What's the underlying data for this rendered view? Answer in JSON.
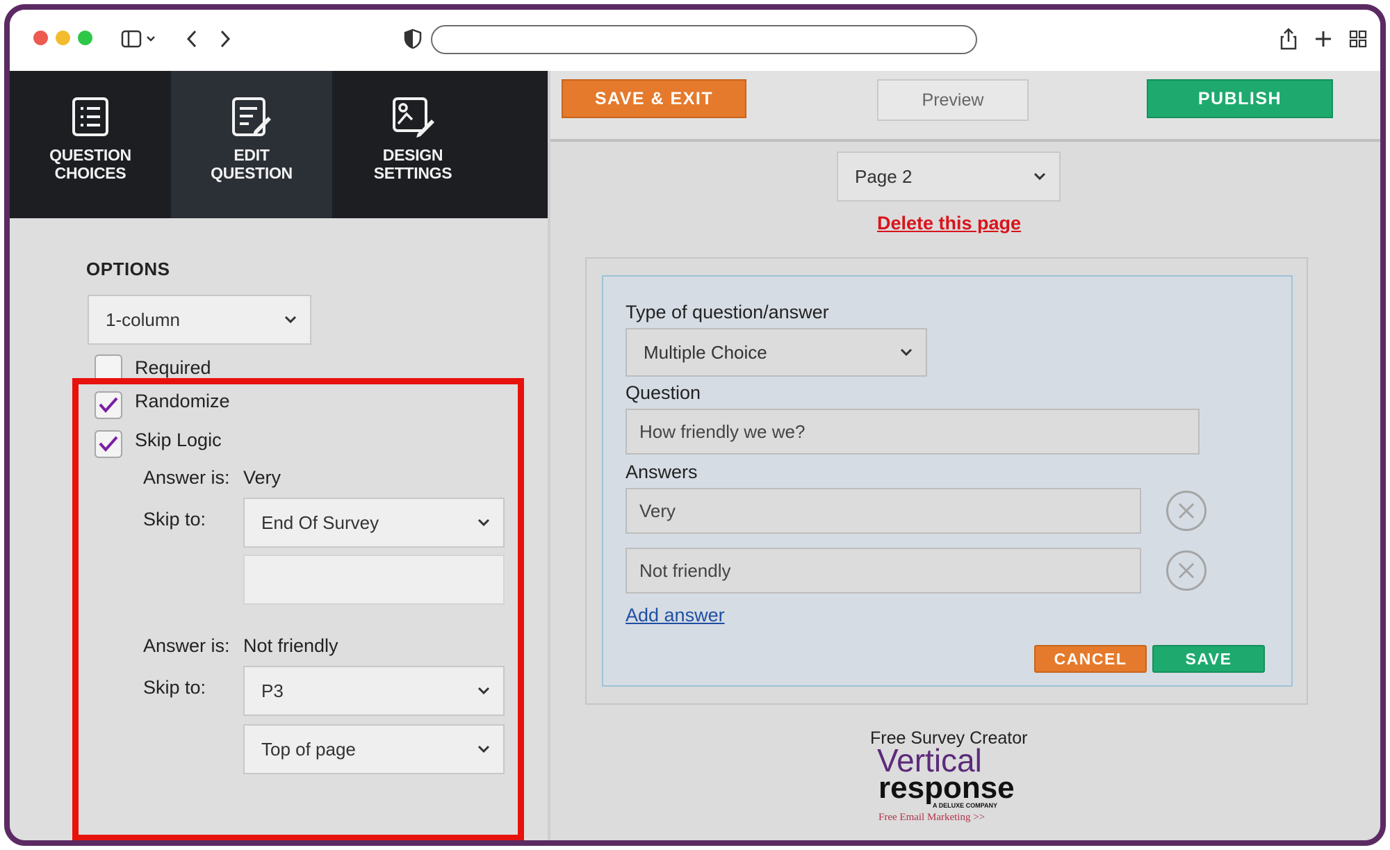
{
  "nav": {
    "items": [
      {
        "label_line1": "QUESTION",
        "label_line2": "CHOICES",
        "icon": "list-icon"
      },
      {
        "label_line1": "EDIT",
        "label_line2": "QUESTION",
        "icon": "edit-icon"
      },
      {
        "label_line1": "DESIGN",
        "label_line2": "SETTINGS",
        "icon": "design-icon"
      }
    ]
  },
  "options": {
    "title": "OPTIONS",
    "columns_select": "1-column",
    "required_label": "Required",
    "required_checked": false,
    "randomize_label": "Randomize",
    "randomize_checked": true,
    "skip_logic_label": "Skip Logic",
    "skip_logic_checked": true,
    "rules": [
      {
        "answer_prefix": "Answer is:",
        "answer_value": "Very",
        "skip_prefix": "Skip to:",
        "skip_select": "End Of Survey"
      },
      {
        "answer_prefix": "Answer is:",
        "answer_value": "Not friendly",
        "skip_prefix": "Skip to:",
        "skip_select": "P3",
        "position_select": "Top of page"
      }
    ]
  },
  "toolbar": {
    "save_exit_label": "SAVE & EXIT",
    "preview_label": "Preview",
    "publish_label": "PUBLISH"
  },
  "page_select": "Page 2",
  "delete_page_label": "Delete this page",
  "editor": {
    "type_label": "Type of question/answer",
    "type_value": "Multiple Choice",
    "question_label": "Question",
    "question_value": "How friendly we we?",
    "answers_label": "Answers",
    "answers": [
      "Very",
      "Not friendly"
    ],
    "add_answer_label": "Add answer",
    "cancel_label": "CANCEL",
    "save_label": "SAVE"
  },
  "footer": {
    "caption": "Free Survey Creator",
    "logo_line1": "Vertical",
    "logo_line2": "response",
    "logo_tagline": "A DELUXE COMPANY",
    "logo_sub": "Free Email Marketing >>"
  },
  "colors": {
    "frame": "#5c2a63",
    "orange": "#e57a2c",
    "green": "#1eaa6e",
    "highlight": "#e8120c",
    "check": "#7a1fa2",
    "link_red": "#d9141b",
    "link_blue": "#1f4fa3"
  }
}
